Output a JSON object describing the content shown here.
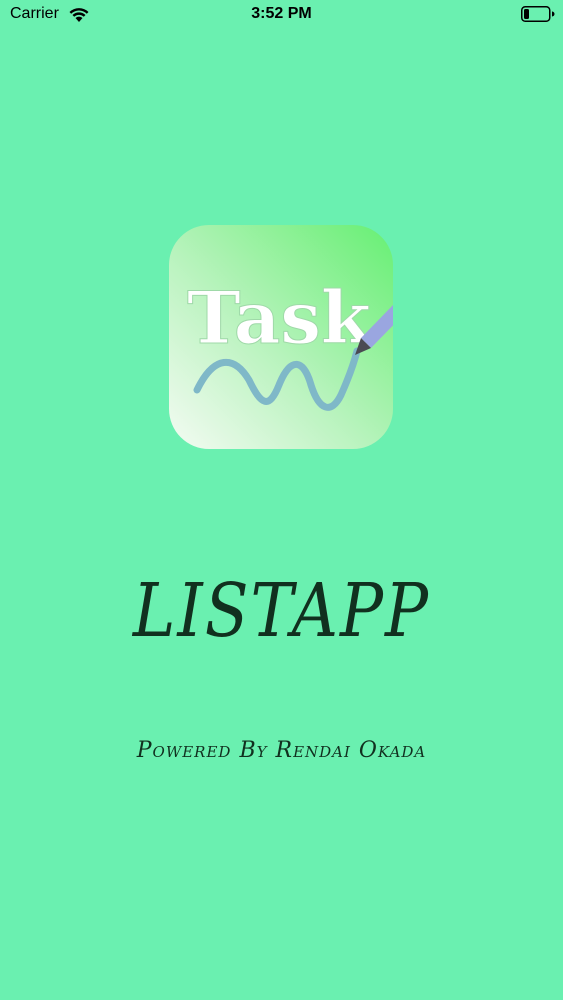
{
  "status_bar": {
    "carrier": "Carrier",
    "time": "3:52 PM",
    "wifi_icon": "wifi-icon",
    "battery_icon": "battery-icon"
  },
  "app_icon": {
    "text": "Task",
    "icon": "pencil-icon"
  },
  "splash": {
    "title": "LISTAPP",
    "subtitle": "Powered By Rendai Okada"
  },
  "colors": {
    "background": "#6af0b0",
    "text": "#11301f",
    "squiggle": "#7fb8c8",
    "pencil": "#9aa6e0"
  }
}
